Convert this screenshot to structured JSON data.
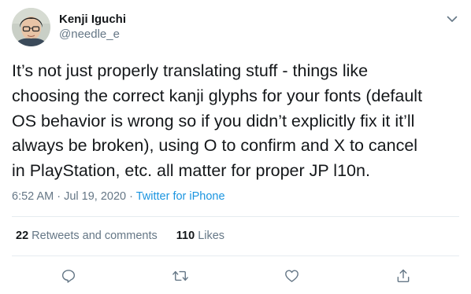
{
  "author": {
    "display_name": "Kenji Iguchi",
    "handle": "@needle_e",
    "avatar_icon": "profile-photo"
  },
  "tweet": {
    "text": "It’s not just properly translating stuff - things like\nchoosing the correct kanji glyphs for your fonts (default\nOS behavior is wrong so if you didn’t explicitly fix it it’ll\nalways be broken), using O to confirm and X to cancel\nin PlayStation, etc. all matter for proper JP l10n.",
    "time": "6:52 AM",
    "date": "Jul 19, 2020",
    "separator": " · ",
    "source": "Twitter for iPhone"
  },
  "stats": {
    "retweets_count": "22",
    "retweets_label": "Retweets and comments",
    "likes_count": "110",
    "likes_label": "Likes"
  },
  "actions": {
    "reply_icon": "comment-icon",
    "retweet_icon": "retweet-icon",
    "like_icon": "heart-icon",
    "share_icon": "share-icon"
  },
  "colors": {
    "text": "#14171a",
    "secondary": "#657786",
    "link": "#1b95e0",
    "divider": "#e6ecf0"
  }
}
